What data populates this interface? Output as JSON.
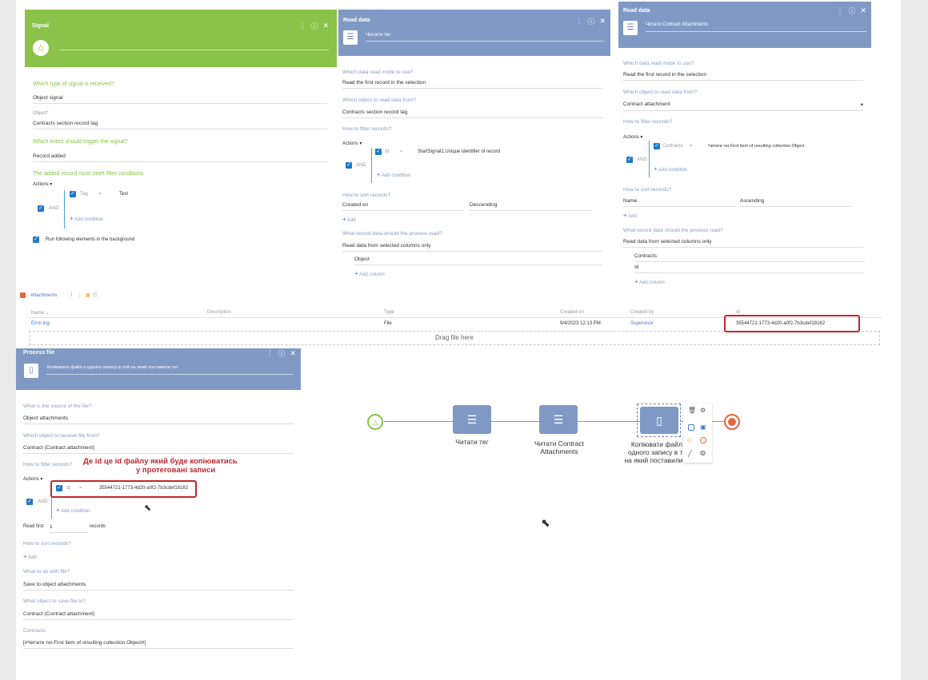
{
  "signal_panel": {
    "title": "Signal",
    "q1": "Which type of signal is received?",
    "v1": "Object signal",
    "object_label": "Object*",
    "object_value": "Contracts section record tag",
    "q2": "Which event should trigger the signal?",
    "v2": "Record added",
    "q3": "The added record must meet filter conditions",
    "actions": "Actions",
    "and": "AND",
    "cond_col": "Tag",
    "cond_op": "=",
    "cond_val": "Test",
    "add_condition": "Add condition",
    "bg_label": "Run following elements in the background"
  },
  "read1_panel": {
    "title": "Read data",
    "name": "Читати тег",
    "q_mode": "Which data read mode to use?",
    "v_mode": "Read the first record in the selection",
    "q_obj": "Which object to read data from?",
    "v_obj": "Contracts section record tag",
    "q_filter": "How to filter records?",
    "actions": "Actions",
    "and": "AND",
    "cond_col": "Id",
    "cond_op": "=",
    "cond_val": "StartSignal1.Unique identifier of record",
    "add_condition": "Add condition",
    "q_sort": "How to sort records?",
    "sort_col": "Created on",
    "sort_dir": "Descending",
    "add": "Add",
    "q_data": "What record data should the process read?",
    "v_data": "Read data from selected columns only",
    "col1": "Object",
    "add_column": "Add column"
  },
  "read2_panel": {
    "title": "Read data",
    "name": "Читати Contract Attachments",
    "q_mode": "Which data read mode to use?",
    "v_mode": "Read the first record in the selection",
    "q_obj": "Which object to read data from?",
    "v_obj": "Contract attachment",
    "q_filter": "How to filter records?",
    "actions": "Actions",
    "and": "AND",
    "cond_col": "Contracts",
    "cond_op": "=",
    "cond_val": "Читати тег.First item of resulting collection.Object",
    "add_condition": "Add condition",
    "q_sort": "How to sort records?",
    "sort_col": "Name",
    "sort_dir": "Ascending",
    "add": "Add",
    "q_data": "What record data should the process read?",
    "v_data": "Read data from selected columns only",
    "col1": "Contracts",
    "col2": "Id",
    "add_column": "Add column"
  },
  "attachments": {
    "title": "Attachments",
    "headers": [
      "Name",
      "Description",
      "Type",
      "Created on",
      "Created by",
      "Id"
    ],
    "row": {
      "name": "Error.log",
      "description": "",
      "type": "File",
      "created_on": "9/4/2023 12:13 PM",
      "created_by": "Supervisor",
      "id": "35544721-1773-4d20-a0f2-7b3cdef18162"
    },
    "drag_text": "Drag file here"
  },
  "process_panel": {
    "title": "Process file",
    "name": "Копіювати файл з одного запису в той на який поставили тег",
    "q_source": "What is the source of the file?",
    "v_source": "Object attachments",
    "q_obj": "Which object to receive file from?",
    "v_obj": "Contract (Contract attachment)",
    "q_filter": "How to filter records?",
    "actions": "Actions",
    "and": "AND",
    "cond_col": "Id",
    "cond_op": "=",
    "cond_val": "35544721-1773-4d20-a0f2-7b3cdef18162",
    "add_condition": "Add condition",
    "read_first": "Read first",
    "read_first_value": "1",
    "records": "records",
    "q_sort": "How to sort records?",
    "add": "Add",
    "q_do": "What to do with file?",
    "v_do": "Save to object attachments",
    "q_save": "What object to save file to?",
    "v_save": "Contract (Contract attachment)",
    "q_contracts": "Contracts",
    "v_contracts": "[#Читати тег.First item of resulting collection.Object#]"
  },
  "annotation": {
    "line1": "Де id це id файлу який буде копіюватись",
    "line2": "у протеговані записи"
  },
  "diagram": {
    "node1": "Читати тег",
    "node2": "Читати Contract Attachments",
    "node3": "Копіювати файл з одного запису в той на який поставили тег"
  },
  "colors": {
    "signal_green": "#8bc34a",
    "read_blue": "#8099c4",
    "annotation_red": "#c0272d",
    "checkbox_blue": "#1f78c8"
  }
}
